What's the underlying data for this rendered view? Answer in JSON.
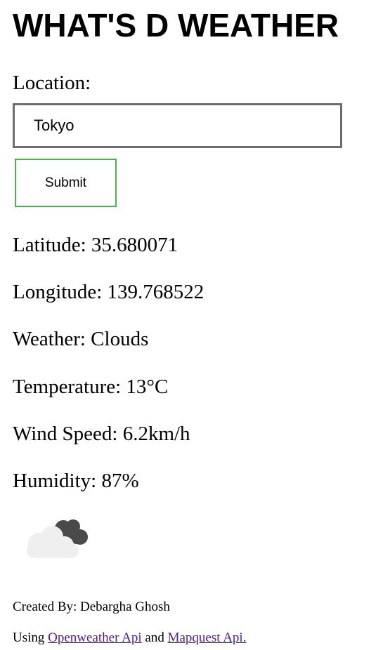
{
  "header": {
    "title": "WHAT'S D WEATHER"
  },
  "form": {
    "location_label": "Location:",
    "location_value": "Tokyo",
    "submit_label": "Submit"
  },
  "results": {
    "latitude": "Latitude: 35.680071",
    "longitude": "Longitude: 139.768522",
    "weather": "Weather: Clouds",
    "temperature": "Temperature: 13°C",
    "wind_speed": "Wind Speed: 6.2km/h",
    "humidity": "Humidity: 87%",
    "icon": "broken-clouds-icon"
  },
  "footer": {
    "created_by": "Created By: Debargha Ghosh",
    "using_prefix": "Using",
    "api1": "Openweather Api",
    "and": "and",
    "api2": "Mapquest Api."
  },
  "colors": {
    "submit_border": "#4caf50",
    "input_border": "#6e6e6e",
    "link": "#551a8b"
  }
}
